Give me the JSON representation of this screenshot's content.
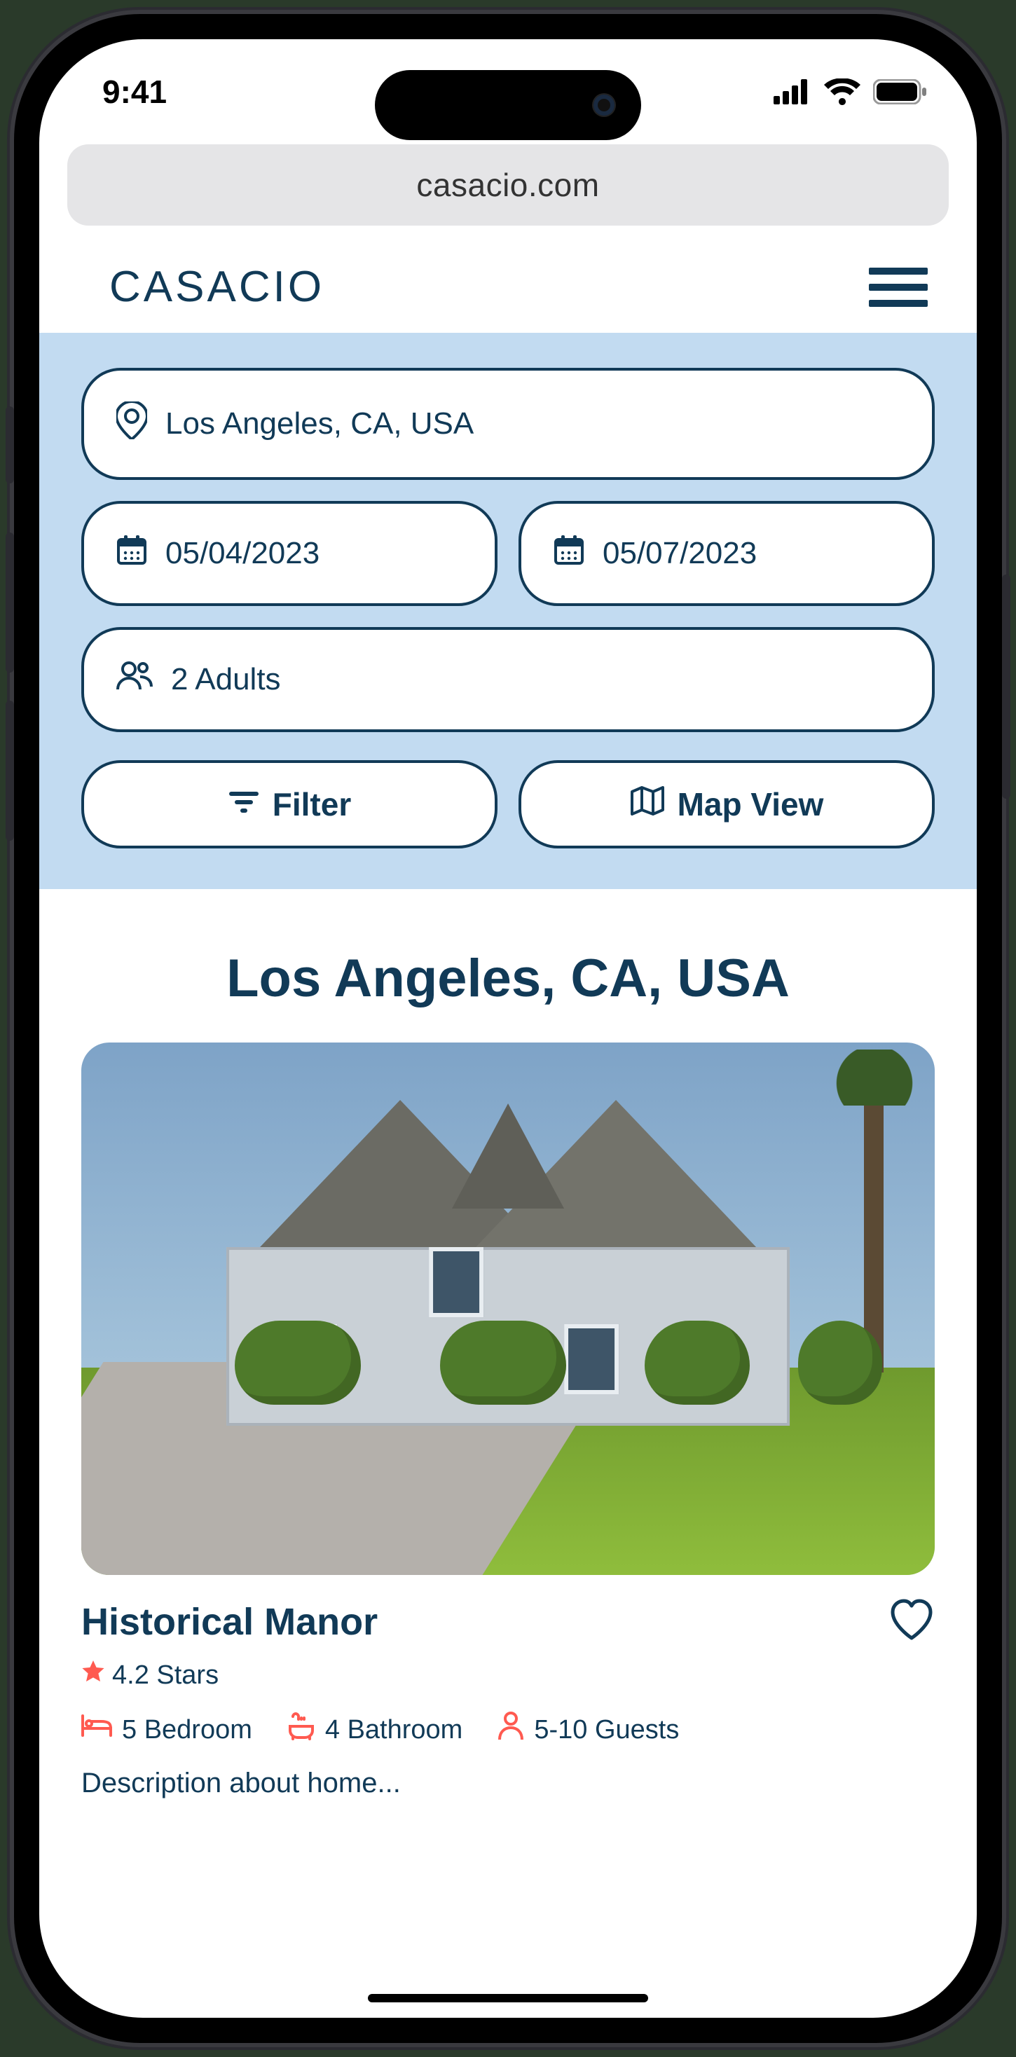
{
  "status": {
    "time": "9:41"
  },
  "browser": {
    "url": "casacio.com"
  },
  "header": {
    "brand": "CASACIO"
  },
  "search": {
    "location": "Los Angeles, CA, USA",
    "date_from": "05/04/2023",
    "date_to": "05/07/2023",
    "guests": "2 Adults",
    "filter_label": "Filter",
    "map_label": "Map View"
  },
  "results": {
    "heading": "Los Angeles, CA, USA",
    "listings": [
      {
        "title": "Historical Manor",
        "rating_text": "4.2 Stars",
        "bedrooms": "5 Bedroom",
        "bathrooms": "4 Bathroom",
        "guests": "5-10 Guests",
        "description": "Description about home..."
      }
    ]
  },
  "colors": {
    "ink": "#113a57",
    "accent": "#ff5a50",
    "panel": "#c2dbf1"
  }
}
